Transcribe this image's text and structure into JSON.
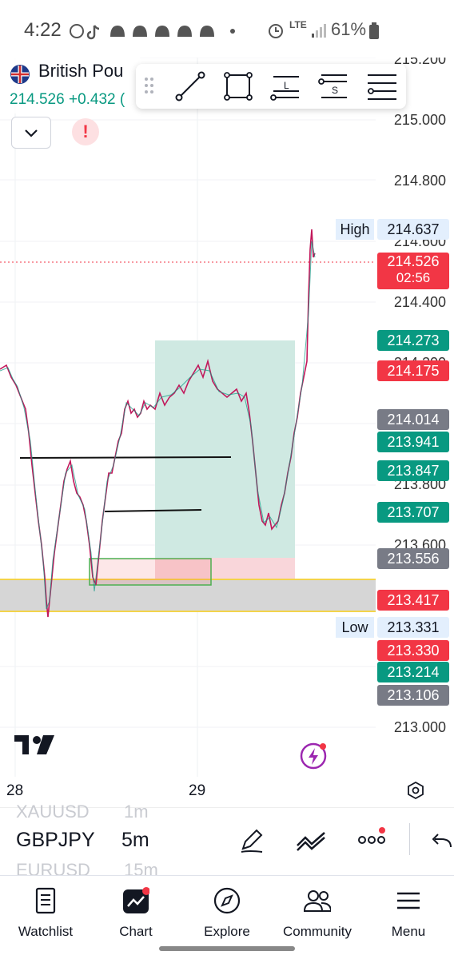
{
  "status_bar": {
    "time": "4:22",
    "network": "LTE",
    "battery": "61%",
    "icons": [
      "whatsapp-icon",
      "tiktok-icon",
      "snapchat-icon",
      "snapchat-icon",
      "snapchat-icon",
      "snapchat-icon",
      "snapchat-icon",
      "dot-icon",
      "alarm-icon",
      "signal-icon",
      "battery-icon"
    ]
  },
  "symbol": {
    "name": "British Pou",
    "price": "214.526",
    "change": "+0.432 (",
    "flag_icon": "uk-flag-icon"
  },
  "drawing_toolbar": {
    "tools": [
      "drag-handle-icon",
      "trend-line-icon",
      "rectangle-icon",
      "long-position-icon",
      "short-position-icon",
      "horizontal-lines-icon"
    ]
  },
  "price_axis": {
    "labels": [
      "215.200",
      "215.000",
      "214.800",
      "214.600",
      "214.400",
      "214.200",
      "213.800",
      "213.600"
    ]
  },
  "price_tags": [
    {
      "label": "High",
      "value": "214.637",
      "style": "light"
    },
    {
      "value": "214.526",
      "sub": "02:56",
      "style": "red"
    },
    {
      "value": "214.273",
      "style": "green"
    },
    {
      "value": "214.175",
      "style": "red"
    },
    {
      "value": "214.014",
      "style": "gray"
    },
    {
      "value": "213.941",
      "style": "green"
    },
    {
      "value": "213.847",
      "style": "green"
    },
    {
      "value": "213.707",
      "style": "green"
    },
    {
      "value": "213.556",
      "style": "gray"
    },
    {
      "value": "213.417",
      "style": "red"
    },
    {
      "label": "Low",
      "value": "213.331",
      "style": "light"
    },
    {
      "value": "213.330",
      "style": "red"
    },
    {
      "value": "213.214",
      "style": "green"
    },
    {
      "value": "213.106",
      "style": "gray"
    }
  ],
  "extra_axis": {
    "bottom_label": "213.000"
  },
  "time_axis": {
    "labels": [
      "28",
      "29"
    ]
  },
  "symbol_strip": {
    "prev_symbol": "XAUUSD",
    "prev_tf": "1m",
    "current_symbol": "GBPJPY",
    "current_tf": "5m",
    "next_symbol": "EURUSD",
    "next_tf": "15m"
  },
  "bottom_nav": {
    "items": [
      {
        "label": "Watchlist",
        "icon": "watchlist-icon"
      },
      {
        "label": "Chart",
        "icon": "chart-icon"
      },
      {
        "label": "Explore",
        "icon": "compass-icon"
      },
      {
        "label": "Community",
        "icon": "community-icon"
      },
      {
        "label": "Menu",
        "icon": "menu-icon"
      }
    ]
  },
  "colors": {
    "up": "#089981",
    "down": "#f23645",
    "accent": "#2962ff",
    "neutral": "#787b86"
  }
}
